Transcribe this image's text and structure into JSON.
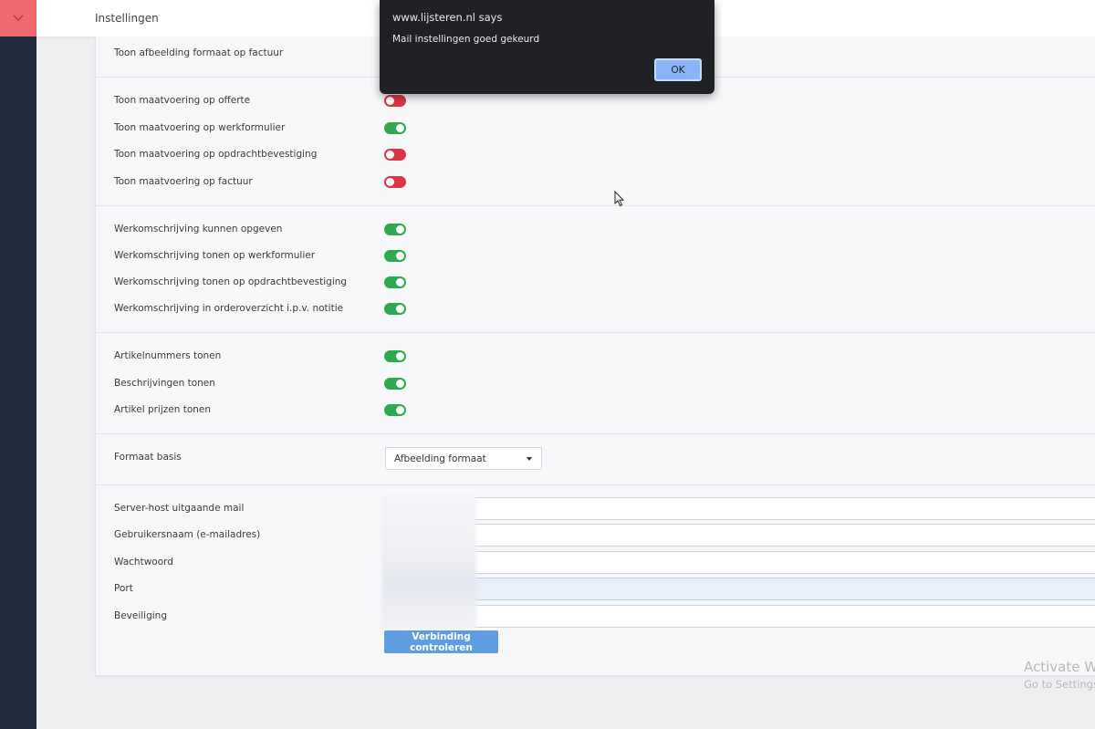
{
  "header": {
    "title": "Instellingen"
  },
  "settings": {
    "top_label": "Toon afbeelding formaat op factuur",
    "maatvoering": [
      {
        "label": "Toon maatvoering op offerte",
        "enabled": false
      },
      {
        "label": "Toon maatvoering op werkformulier",
        "enabled": true
      },
      {
        "label": "Toon maatvoering op opdrachtbevestiging",
        "enabled": false
      },
      {
        "label": "Toon maatvoering op factuur",
        "enabled": false
      }
    ],
    "werkomschrijving": [
      {
        "label": "Werkomschrijving kunnen opgeven",
        "enabled": true
      },
      {
        "label": "Werkomschrijving tonen op werkformulier",
        "enabled": true
      },
      {
        "label": "Werkomschrijving tonen op opdrachtbevestiging",
        "enabled": true
      },
      {
        "label": "Werkomschrijving in orderoverzicht i.p.v. notitie",
        "enabled": true
      }
    ],
    "artikel": [
      {
        "label": "Artikelnummers tonen",
        "enabled": true
      },
      {
        "label": "Beschrijvingen tonen",
        "enabled": true
      },
      {
        "label": "Artikel prijzen tonen",
        "enabled": true
      }
    ],
    "format": {
      "label": "Formaat basis",
      "selected": "Afbeelding formaat"
    },
    "mail": {
      "fields": [
        {
          "label": "Server-host uitgaande mail"
        },
        {
          "label": "Gebruikersnaam (e-mailadres)"
        },
        {
          "label": "Wachtwoord"
        },
        {
          "label": "Port"
        },
        {
          "label": "Beveiliging"
        }
      ],
      "check_button": "Verbinding controleren"
    }
  },
  "dialog": {
    "title": "www.lijsteren.nl says",
    "message": "Mail instellingen goed gekeurd",
    "ok_label": "OK"
  },
  "watermark": {
    "line1": "Activate W",
    "line2": "Go to Settings"
  },
  "colors": {
    "toggle_on": "#2fa84f",
    "toggle_off": "#dc3545",
    "accent": "#ef6a6c",
    "sidebar": "#222a3d",
    "button": "#5e9de0"
  }
}
